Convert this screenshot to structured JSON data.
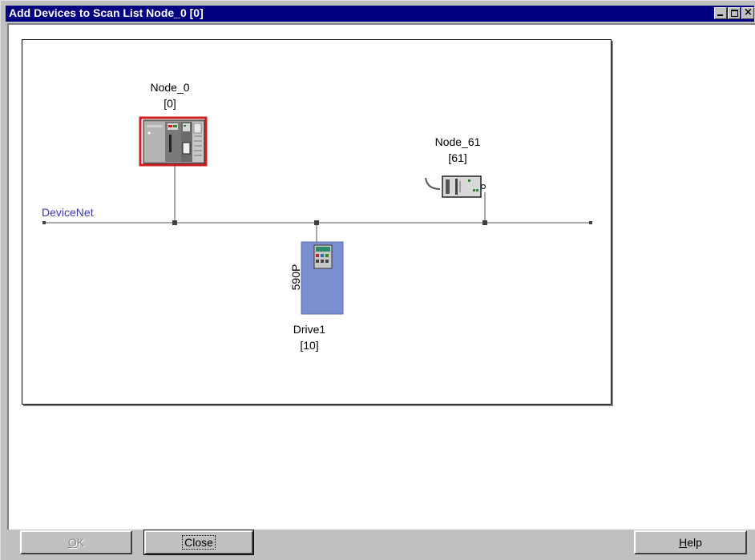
{
  "window": {
    "title": "Add Devices to Scan List Node_0 [0]"
  },
  "network": {
    "name": "DeviceNet",
    "color": "#3a3ab0"
  },
  "devices": [
    {
      "name": "Node_0",
      "address": "[0]",
      "icon": "plc-chassis-icon",
      "selected": true,
      "selection_color": "#cc2020"
    },
    {
      "name": "Node_61",
      "address": "[61]",
      "icon": "scanner-module-icon"
    },
    {
      "name": "Drive1",
      "address": "[10]",
      "icon": "drive-icon",
      "model": "590P",
      "color": "#7b8fd0"
    }
  ],
  "buttons": {
    "ok": {
      "label_mnemonic": "O",
      "label_rest": "K",
      "enabled": false
    },
    "close": {
      "label": "Close"
    },
    "help": {
      "label_mnemonic": "H",
      "label_rest": "elp"
    }
  }
}
